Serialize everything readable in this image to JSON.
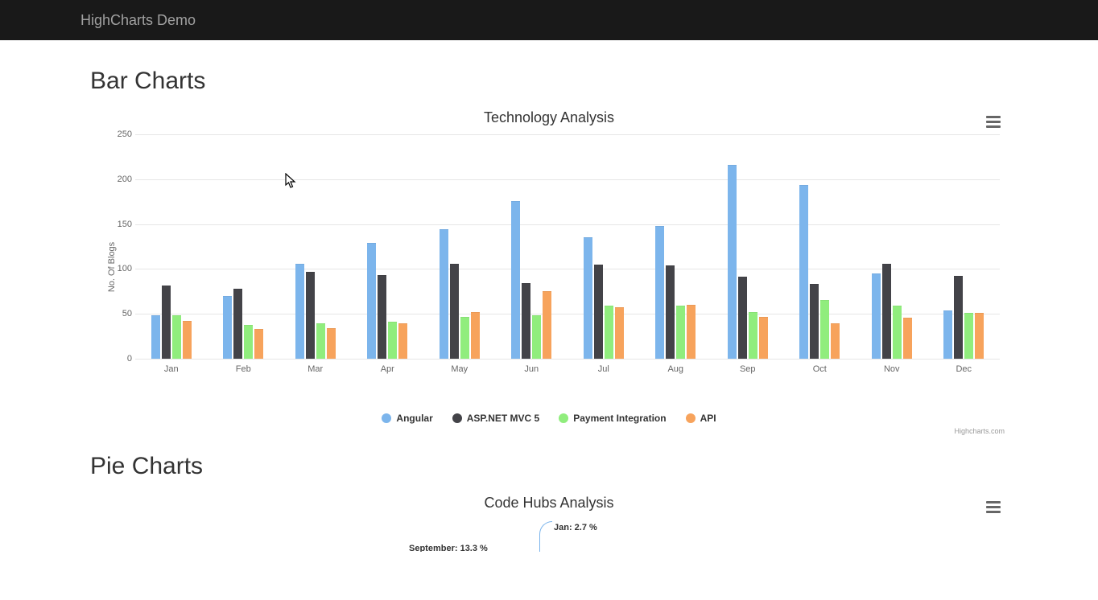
{
  "navbar": {
    "brand": "HighCharts Demo"
  },
  "section1": {
    "title": "Bar Charts"
  },
  "section2": {
    "title": "Pie Charts"
  },
  "credits": "Highcharts.com",
  "chart_data": [
    {
      "type": "bar",
      "title": "Technology Analysis",
      "ylabel": "No. Of Blogs",
      "xlabel": "",
      "ylim": [
        0,
        250
      ],
      "y_ticks": [
        0,
        50,
        100,
        150,
        200,
        250
      ],
      "categories": [
        "Jan",
        "Feb",
        "Mar",
        "Apr",
        "May",
        "Jun",
        "Jul",
        "Aug",
        "Sep",
        "Oct",
        "Nov",
        "Dec"
      ],
      "series": [
        {
          "name": "Angular",
          "color": "#7cb5ec",
          "values": [
            48,
            70,
            106,
            129,
            144,
            176,
            135,
            148,
            216,
            194,
            95,
            54
          ]
        },
        {
          "name": "ASP.NET MVC 5",
          "color": "#434348",
          "values": [
            82,
            78,
            97,
            93,
            106,
            84,
            105,
            104,
            91,
            83,
            106,
            92
          ]
        },
        {
          "name": "Payment Integration",
          "color": "#90ed7d",
          "values": [
            48,
            38,
            39,
            41,
            47,
            48,
            59,
            59,
            52,
            65,
            59,
            51
          ]
        },
        {
          "name": "API",
          "color": "#f7a35c",
          "values": [
            42,
            33,
            34,
            39,
            52,
            75,
            57,
            60,
            47,
            39,
            46,
            51
          ]
        }
      ]
    },
    {
      "type": "pie",
      "title": "Code Hubs Analysis",
      "visible_labels": [
        {
          "text": "Jan: 2.7 %"
        },
        {
          "text": "September: 13.3 %"
        }
      ]
    }
  ]
}
